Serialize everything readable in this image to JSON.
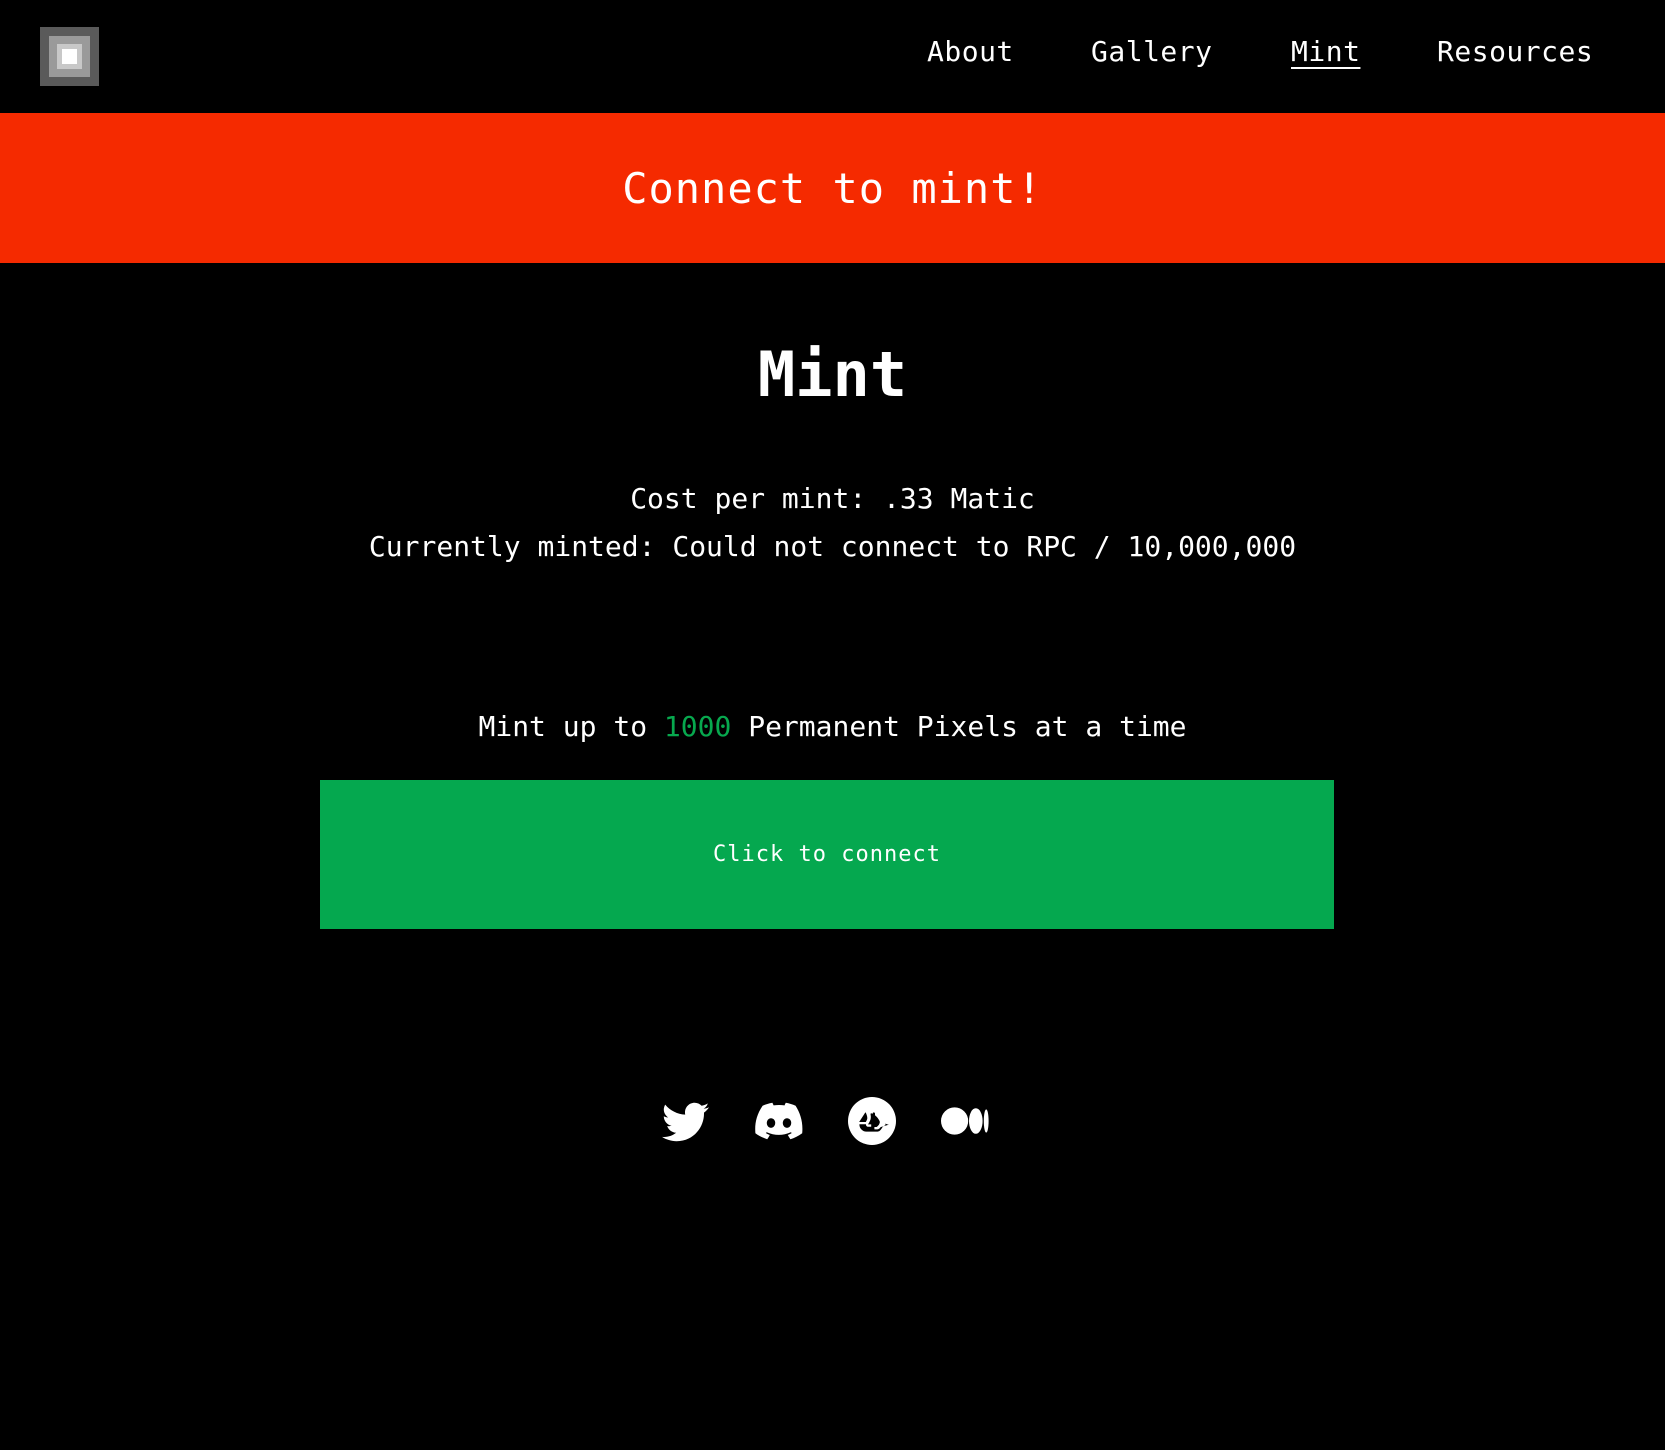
{
  "header": {
    "logo": "permanent-pixels-logo",
    "nav": [
      {
        "label": "About"
      },
      {
        "label": "Gallery"
      },
      {
        "label": "Mint",
        "active": true
      },
      {
        "label": "Resources"
      }
    ]
  },
  "banner": {
    "text": "Connect to mint!",
    "color": "#f52a00"
  },
  "main": {
    "title": "Mint",
    "cost_line": "Cost per mint: .33 Matic",
    "minted_line": "Currently minted: Could not connect to RPC / 10,000,000",
    "limit_prefix": "Mint up to ",
    "limit_value": "1000",
    "limit_suffix": " Permanent Pixels at a time",
    "accent_color": "#07a84e",
    "connect_button": "Click to connect"
  },
  "social": [
    {
      "icon": "twitter-icon"
    },
    {
      "icon": "discord-icon"
    },
    {
      "icon": "opensea-icon"
    },
    {
      "icon": "medium-icon"
    }
  ]
}
